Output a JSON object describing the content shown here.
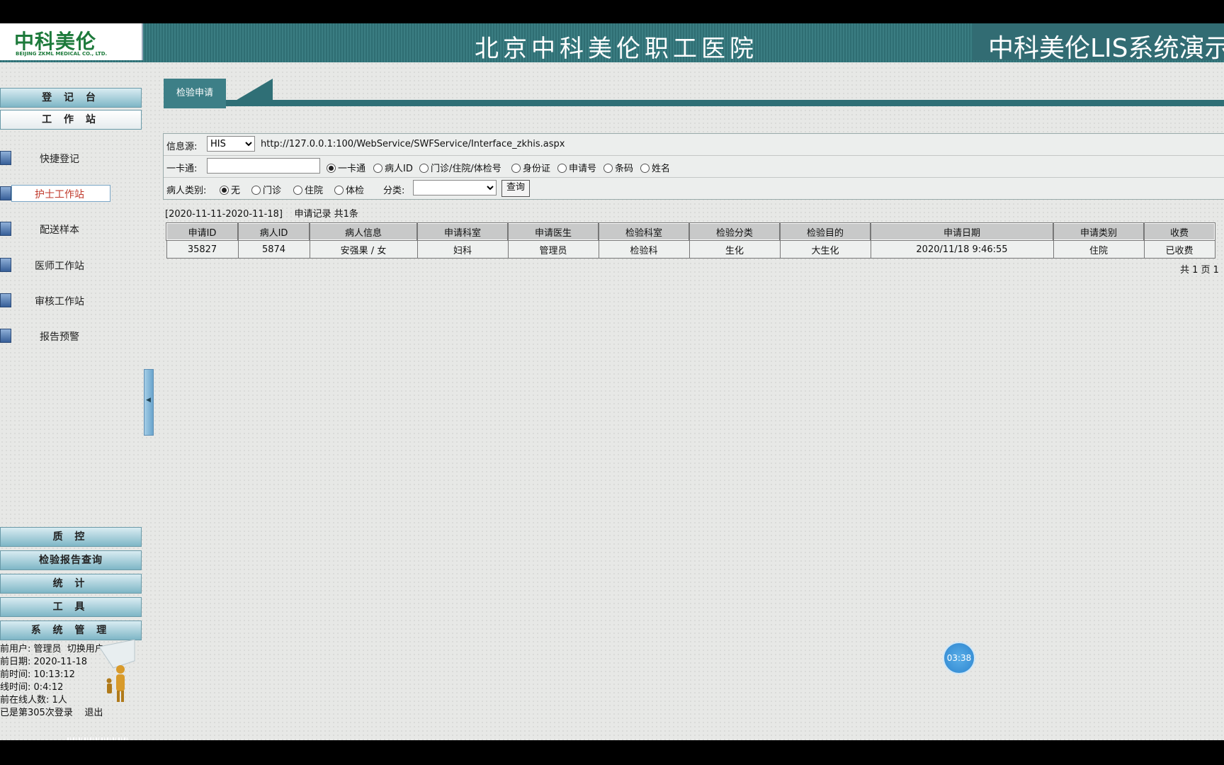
{
  "header": {
    "logo_cn": "中科美伦",
    "logo_en": "BEIJING ZKML MEDICAL CO., LTD.",
    "hospital_title": "北京中科美伦职工医院",
    "system_title": "中科美伦LIS系统演示"
  },
  "sidebar": {
    "register_label": "登 记 台",
    "workstation_label": "工 作 站",
    "items": [
      {
        "label": "快捷登记"
      },
      {
        "label": "护士工作站"
      },
      {
        "label": "配送样本"
      },
      {
        "label": "医师工作站"
      },
      {
        "label": "审核工作站"
      },
      {
        "label": "报告预警"
      }
    ],
    "bottom_nav": [
      {
        "label": "质 控"
      },
      {
        "label": "检验报告查询"
      },
      {
        "label": "统 计"
      },
      {
        "label": "工 具"
      },
      {
        "label": "系 统 管 理"
      }
    ],
    "user": {
      "current_user": "前用户: 管理员",
      "switch_user": "切换用户",
      "date": "前日期: 2020-11-18",
      "time": "前时间: 10:13:12",
      "online_time": "线时间: 0:4:12",
      "online_count": "前在线人数: 1人",
      "login_count": "已是第305次登录",
      "logout": "退出"
    }
  },
  "tab": {
    "label": "检验申请"
  },
  "form": {
    "source_label": "信息源:",
    "source_value": "HIS",
    "source_url": "http://127.0.0.1:100/WebService/SWFService/Interface_zkhis.aspx",
    "card_label": "一卡通:",
    "card_value": "",
    "search_options": [
      "一卡通",
      "病人ID",
      "门诊/住院/体检号",
      "身份证",
      "申请号",
      "条码",
      "姓名"
    ],
    "patient_type_label": "病人类别:",
    "patient_types": [
      "无",
      "门诊",
      "住院",
      "体检"
    ],
    "category_label": "分类:",
    "category_value": "",
    "query_button": "查询"
  },
  "summary": {
    "range": "[2020-11-11-2020-11-18]",
    "records": "申请记录 共1条"
  },
  "table": {
    "headers": [
      "申请ID",
      "病人ID",
      "病人信息",
      "申请科室",
      "申请医生",
      "检验科室",
      "检验分类",
      "检验目的",
      "申请日期",
      "申请类别",
      "收费"
    ],
    "rows": [
      [
        "35827",
        "5874",
        "安强果 / 女",
        "妇科",
        "管理员",
        "检验科",
        "生化",
        "大生化",
        "2020/11/18 9:46:55",
        "住院",
        "已收费"
      ]
    ]
  },
  "pager": {
    "text": "共 1 页 1"
  },
  "timer": {
    "text": "03:38"
  }
}
